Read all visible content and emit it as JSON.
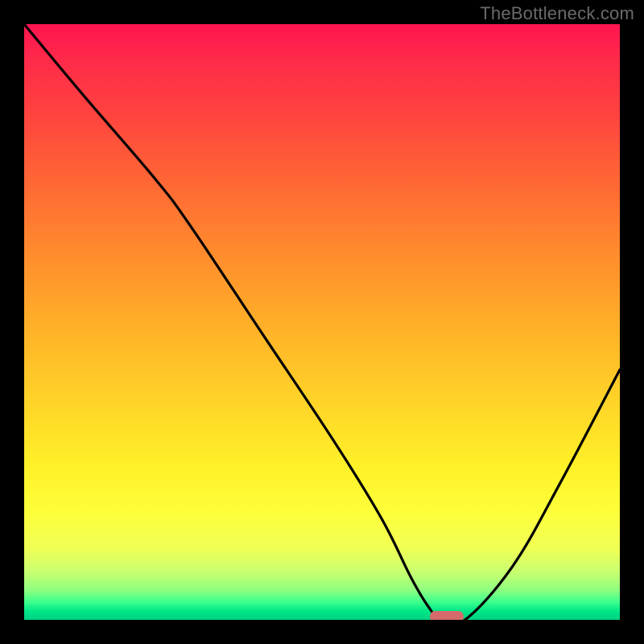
{
  "watermark": "TheBottleneck.com",
  "chart_data": {
    "type": "line",
    "title": "",
    "xlabel": "",
    "ylabel": "",
    "xlim": [
      0,
      100
    ],
    "ylim": [
      0,
      100
    ],
    "x": [
      0,
      10,
      22,
      28,
      40,
      52,
      60,
      65,
      68,
      70,
      74,
      82,
      90,
      100
    ],
    "values": [
      100,
      88,
      74,
      66,
      48,
      30,
      17,
      7,
      2,
      0,
      0,
      9,
      23,
      42
    ],
    "marker": {
      "x": 71,
      "y": 0
    },
    "gradient_stops": [
      {
        "pos": 0,
        "color": "#ff1450"
      },
      {
        "pos": 0.5,
        "color": "#ffae28"
      },
      {
        "pos": 0.82,
        "color": "#fdff3a"
      },
      {
        "pos": 1.0,
        "color": "#00d084"
      }
    ]
  }
}
